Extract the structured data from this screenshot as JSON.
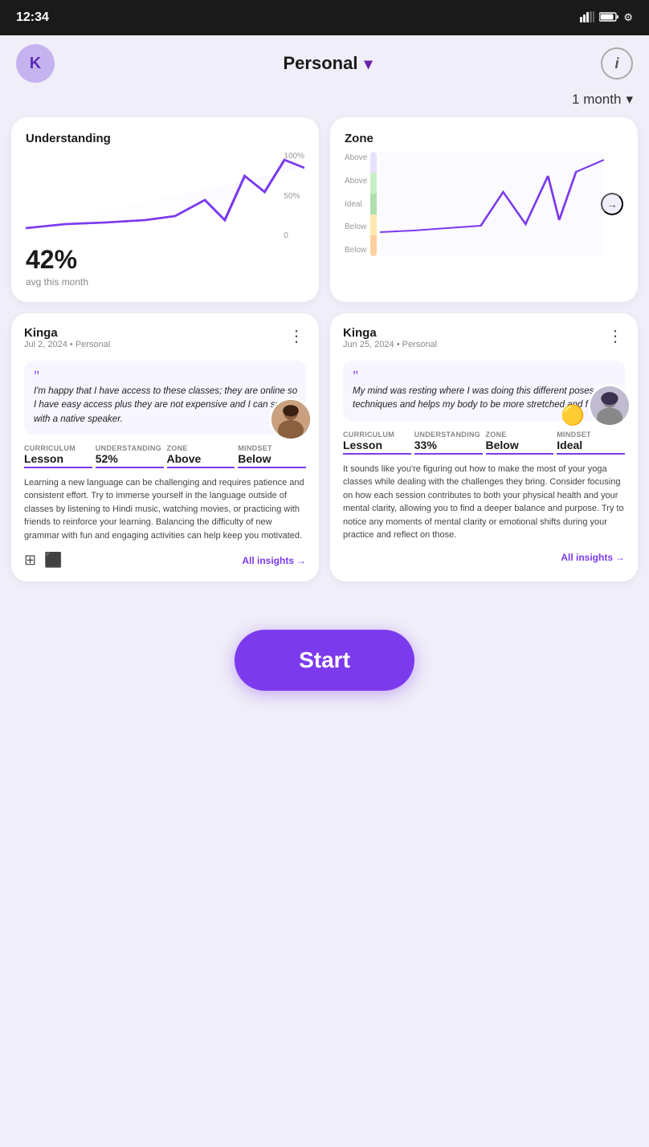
{
  "statusBar": {
    "time": "12:34",
    "icons": "📶🔋⚙"
  },
  "header": {
    "avatarInitial": "K",
    "title": "Personal",
    "infoLabel": "i"
  },
  "timeFilter": {
    "label": "1 month",
    "chevron": "▾"
  },
  "understandingCard": {
    "title": "Understanding",
    "percent": "42%",
    "avgLabel": "avg this month",
    "yLabels": [
      "100%",
      "50%",
      "0"
    ],
    "chartColor": "#7c3aed"
  },
  "zoneCard": {
    "title": "Zone",
    "yLabels": [
      "Above",
      "Above",
      "Ideal",
      "Below",
      "Below"
    ],
    "arrowLabel": "→"
  },
  "insightCard1": {
    "userName": "Kinga",
    "date": "Jul 2, 2024",
    "context": "Personal",
    "quoteText": "I'm happy that I have access to these classes; they are online so I have easy access plus they are not expensive and I can speak with a native speaker.",
    "metrics": {
      "curriculum": {
        "label": "CURRICULUM",
        "value": "Lesson"
      },
      "understanding": {
        "label": "UNDERSTANDING",
        "value": "52%"
      },
      "zone": {
        "label": "ZONE",
        "value": "Above"
      },
      "mindset": {
        "label": "MINDSET",
        "value": "Below"
      }
    },
    "bodyText": "Learning a new language can be challenging and requires patience and consistent effort. Try to immerse yourself in the language outside of classes by listening to Hindi music, watching movies, or practicing with friends to reinforce your learning. Balancing the difficulty of new grammar with fun and engaging activities can help keep you motivated.",
    "allInsightsLabel": "All insights"
  },
  "insightCard2": {
    "userName": "Kinga",
    "date": "Jun 25, 2024",
    "context": "Personal",
    "quoteText": "My mind was resting where I was doing this different poses and techniques and helps my body to be more stretched and flexible.",
    "emojiBadge": "🟡",
    "metrics": {
      "curriculum": {
        "label": "CURRICULUM",
        "value": "Lesson"
      },
      "understanding": {
        "label": "UNDERSTANDING",
        "value": "33%"
      },
      "zone": {
        "label": "ZONE",
        "value": "Below"
      },
      "mindset": {
        "label": "MINDSET",
        "value": "Ideal"
      }
    },
    "bodyText": "It sounds like you're figuring out how to make the most of your yoga classes while dealing with the challenges they bring. Consider focusing on how each session contributes to both your physical health and your mental clarity, allowing you to find a deeper balance and purpose. Try to notice any moments of mental clarity or emotional shifts during your practice and reflect on those.",
    "allInsightsLabel": "All insights"
  },
  "startButton": {
    "label": "Start"
  }
}
